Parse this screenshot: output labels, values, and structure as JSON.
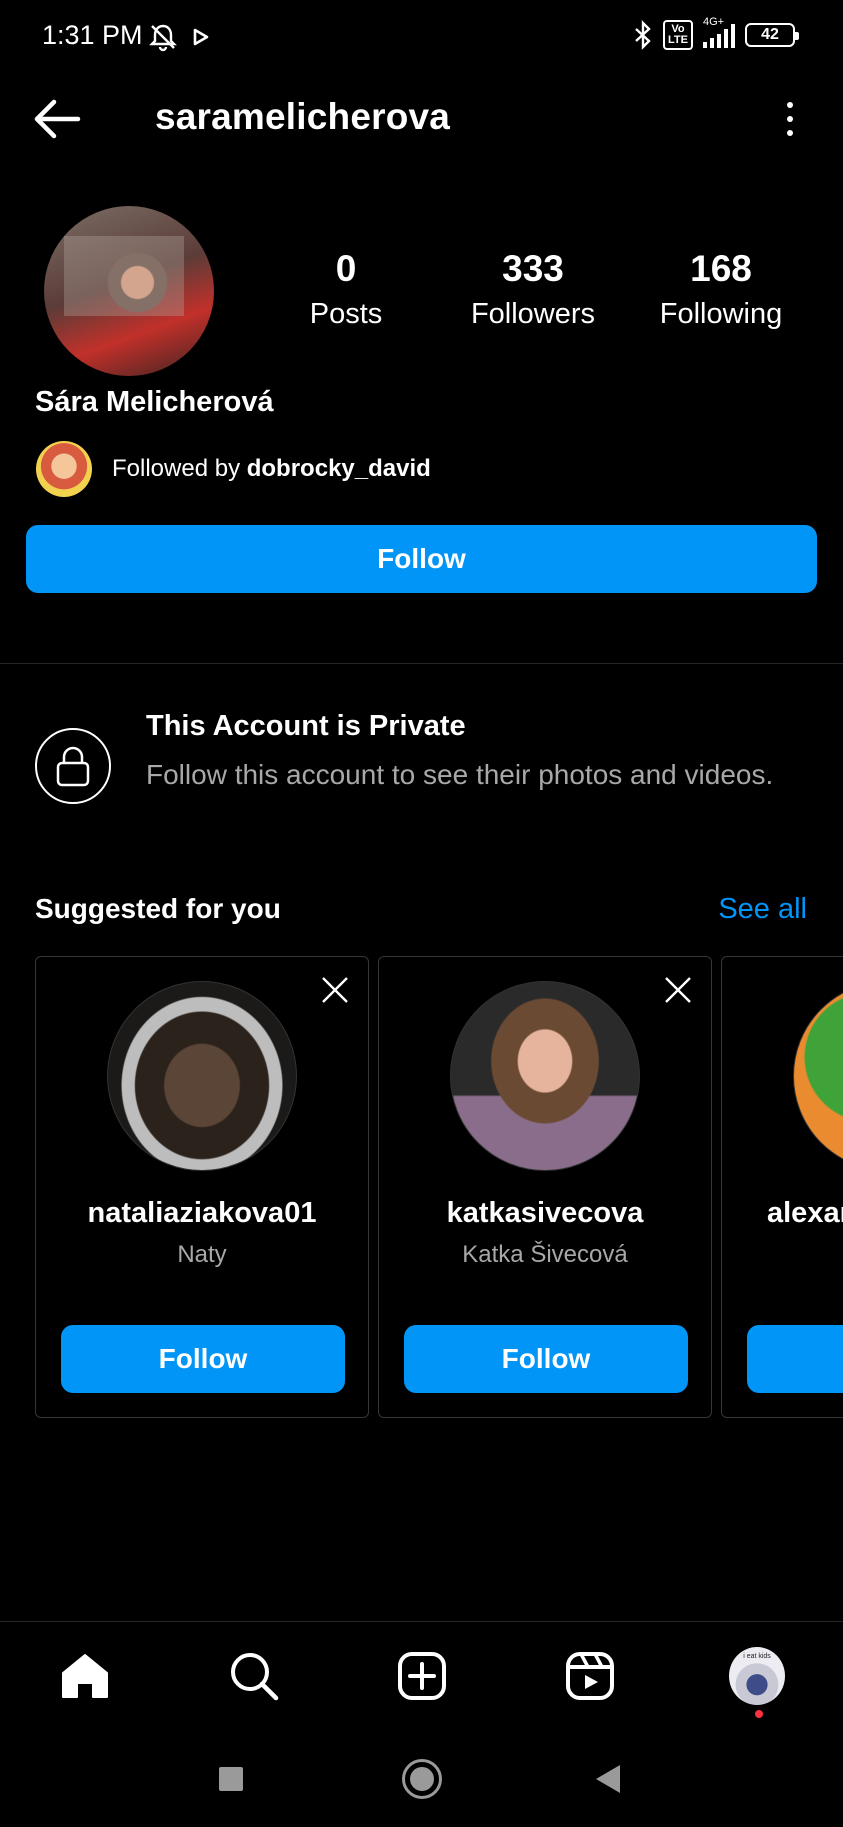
{
  "status_bar": {
    "time": "1:31 PM",
    "volte_label": "Vo\nLTE",
    "network": "4G+",
    "battery": "42"
  },
  "header": {
    "username": "saramelicherova"
  },
  "profile": {
    "posts_count": "0",
    "posts_label": "Posts",
    "followers_count": "333",
    "followers_label": "Followers",
    "following_count": "168",
    "following_label": "Following",
    "full_name": "Sára Melicherová",
    "followed_by_prefix": "Followed by ",
    "followed_by_user": "dobrocky_david",
    "follow_button": "Follow"
  },
  "private": {
    "title": "This Account is Private",
    "description": "Follow this account to see their photos and videos."
  },
  "suggested": {
    "title": "Suggested for you",
    "see_all": "See all",
    "cards": [
      {
        "username": "nataliaziakova01",
        "name": "Naty",
        "button": "Follow"
      },
      {
        "username": "katkasivecova",
        "name": "Katka Šivecová",
        "button": "Follow"
      },
      {
        "username": "alexan",
        "name": "",
        "button": ""
      }
    ]
  },
  "colors": {
    "accent": "#0095f6",
    "background": "#000000",
    "secondary_text": "#a8a8a8"
  },
  "icons": {
    "nav": [
      "home-icon",
      "search-icon",
      "create-icon",
      "reels-icon",
      "profile-avatar"
    ]
  }
}
